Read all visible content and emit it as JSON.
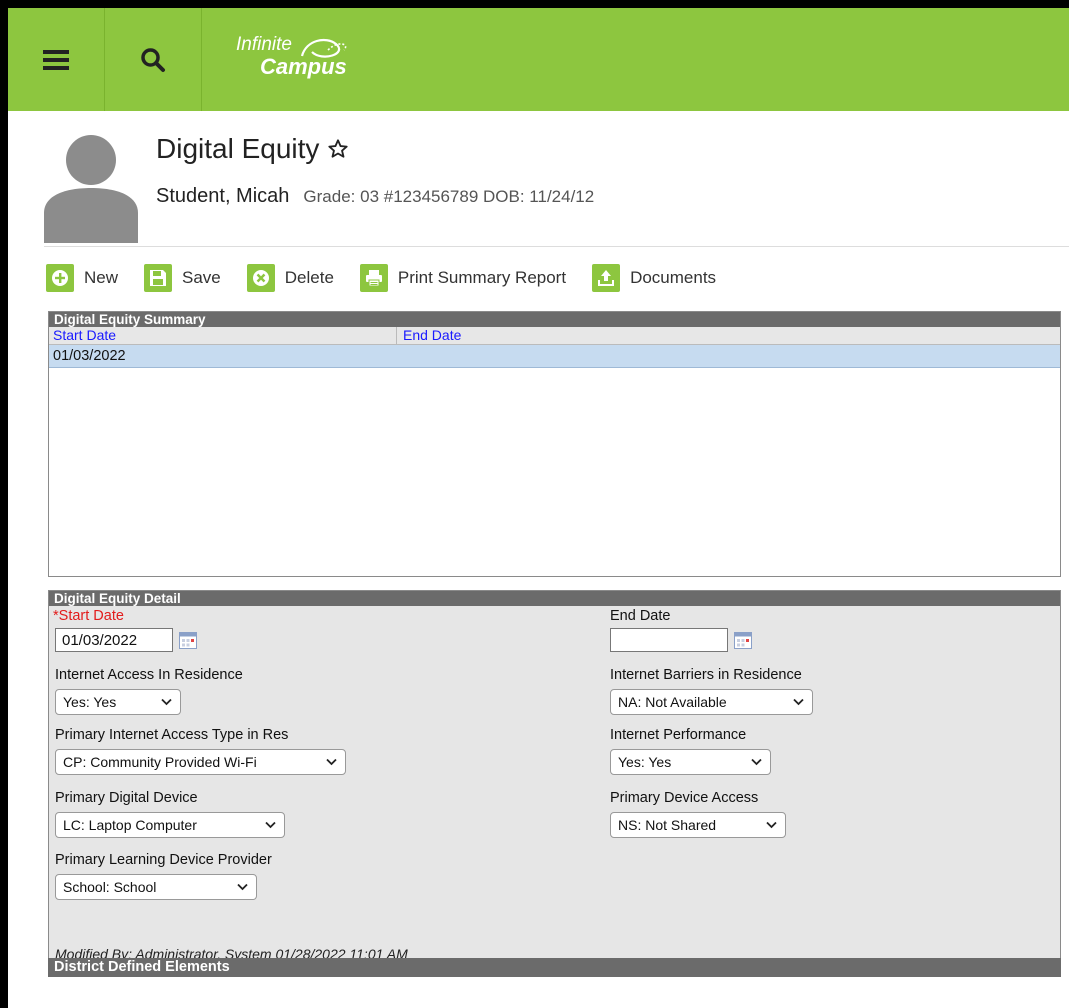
{
  "app": {
    "logo_line1": "Infinite",
    "logo_line2": "Campus"
  },
  "header": {
    "title": "Digital Equity",
    "student_name": "Student, Micah",
    "student_meta": "Grade: 03 #123456789 DOB: 11/24/12"
  },
  "toolbar": {
    "new_label": "New",
    "save_label": "Save",
    "delete_label": "Delete",
    "print_label": "Print Summary Report",
    "documents_label": "Documents"
  },
  "summary": {
    "title": "Digital Equity Summary",
    "columns": [
      "Start Date",
      "End Date"
    ],
    "rows": [
      {
        "start": "01/03/2022",
        "end": ""
      }
    ]
  },
  "detail": {
    "title": "Digital Equity Detail",
    "start_date_label": "*Start Date",
    "start_date_value": "01/03/2022",
    "end_date_label": "End Date",
    "end_date_value": "",
    "internet_access_label": "Internet Access In Residence",
    "internet_access_value": "Yes: Yes",
    "internet_barriers_label": "Internet Barriers in Residence",
    "internet_barriers_value": "NA: Not Available",
    "access_type_label": "Primary Internet Access Type in Res",
    "access_type_value": "CP: Community Provided Wi-Fi",
    "performance_label": "Internet Performance",
    "performance_value": "Yes: Yes",
    "device_label": "Primary Digital Device",
    "device_value": "LC: Laptop Computer",
    "device_access_label": "Primary Device Access",
    "device_access_value": "NS: Not Shared",
    "provider_label": "Primary Learning Device Provider",
    "provider_value": "School: School",
    "modified_by": "Modified By: Administrator, System 01/28/2022 11:01 AM"
  },
  "district": {
    "title": "District Defined Elements"
  },
  "colors": {
    "brand_green": "#8dc63f",
    "panel_header": "#6b6b6b",
    "selected_row": "#c6dbf0",
    "required_red": "#e21c1c",
    "link_blue": "#1a1aff"
  }
}
